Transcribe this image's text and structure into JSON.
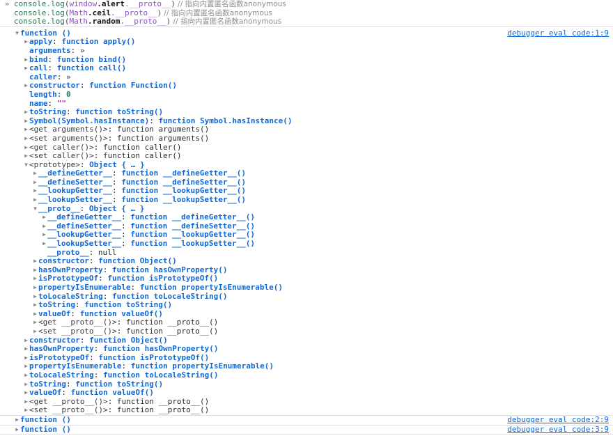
{
  "console": {
    "prompt_chevron": "»",
    "input_lines": [
      {
        "prompt": "»",
        "segments": [
          {
            "t": "console.log",
            "c": "fn"
          },
          {
            "t": "(",
            "c": "punc"
          },
          {
            "t": "window",
            "c": "obj"
          },
          {
            "t": ".alert",
            "c": "prop"
          },
          {
            "t": ".__proto__",
            "c": "obj"
          },
          {
            "t": ")",
            "c": "punc"
          },
          {
            "t": " // 指向内置匿名函数anonymous",
            "c": "comment"
          }
        ]
      },
      {
        "prompt": "",
        "segments": [
          {
            "t": "console.log",
            "c": "fn"
          },
          {
            "t": "(",
            "c": "punc"
          },
          {
            "t": "Math",
            "c": "obj"
          },
          {
            "t": ".ceil",
            "c": "prop"
          },
          {
            "t": ".__proto__",
            "c": "obj"
          },
          {
            "t": ")",
            "c": "punc"
          },
          {
            "t": " // 指向内置匿名函数anonymous",
            "c": "comment"
          }
        ]
      },
      {
        "prompt": "",
        "segments": [
          {
            "t": "console.log",
            "c": "fn"
          },
          {
            "t": "(",
            "c": "punc"
          },
          {
            "t": "Math",
            "c": "obj"
          },
          {
            "t": ".random",
            "c": "prop"
          },
          {
            "t": ".__proto__",
            "c": "obj"
          },
          {
            "t": ")",
            "c": "punc"
          },
          {
            "t": " // 指向内置匿名函数anonymous",
            "c": "comment"
          }
        ]
      }
    ],
    "outputs": [
      {
        "source_link": "debugger eval code:1:9",
        "nodes": [
          {
            "depth": 0,
            "twisty": "open",
            "key": "function ()",
            "key_class": "val-fn",
            "sep": "",
            "value": "",
            "value_class": ""
          },
          {
            "depth": 1,
            "twisty": "closed",
            "key": "apply",
            "key_class": "key",
            "sep": ": ",
            "value": "function apply()",
            "value_class": "val-fn"
          },
          {
            "depth": 1,
            "twisty": "none",
            "key": "arguments",
            "key_class": "key",
            "sep": ": ",
            "value": "»",
            "value_class": "val-plain"
          },
          {
            "depth": 1,
            "twisty": "closed",
            "key": "bind",
            "key_class": "key",
            "sep": ": ",
            "value": "function bind()",
            "value_class": "val-fn"
          },
          {
            "depth": 1,
            "twisty": "closed",
            "key": "call",
            "key_class": "key",
            "sep": ": ",
            "value": "function call()",
            "value_class": "val-fn"
          },
          {
            "depth": 1,
            "twisty": "none",
            "key": "caller",
            "key_class": "key",
            "sep": ": ",
            "value": "»",
            "value_class": "val-plain"
          },
          {
            "depth": 1,
            "twisty": "closed",
            "key": "constructor",
            "key_class": "key",
            "sep": ": ",
            "value": "function Function()",
            "value_class": "val-fn"
          },
          {
            "depth": 1,
            "twisty": "none",
            "key": "length",
            "key_class": "key",
            "sep": ": ",
            "value": "0",
            "value_class": "val-num"
          },
          {
            "depth": 1,
            "twisty": "none",
            "key": "name",
            "key_class": "key",
            "sep": ": ",
            "value": "\"\"",
            "value_class": "val-str"
          },
          {
            "depth": 1,
            "twisty": "closed",
            "key": "toString",
            "key_class": "key",
            "sep": ": ",
            "value": "function toString()",
            "value_class": "val-fn"
          },
          {
            "depth": 1,
            "twisty": "closed",
            "key": "Symbol(Symbol.hasInstance)",
            "key_class": "key",
            "sep": ": ",
            "value": "function Symbol.hasInstance()",
            "value_class": "val-fn"
          },
          {
            "depth": 1,
            "twisty": "closed",
            "key": "<get arguments()>",
            "key_class": "key-dim",
            "sep": ": ",
            "value": "function arguments()",
            "value_class": "val-plain"
          },
          {
            "depth": 1,
            "twisty": "closed",
            "key": "<set arguments()>",
            "key_class": "key-dim",
            "sep": ": ",
            "value": "function arguments()",
            "value_class": "val-plain"
          },
          {
            "depth": 1,
            "twisty": "closed",
            "key": "<get caller()>",
            "key_class": "key-dim",
            "sep": ": ",
            "value": "function caller()",
            "value_class": "val-plain"
          },
          {
            "depth": 1,
            "twisty": "closed",
            "key": "<set caller()>",
            "key_class": "key-dim",
            "sep": ": ",
            "value": "function caller()",
            "value_class": "val-plain"
          },
          {
            "depth": 1,
            "twisty": "open",
            "key": "<prototype>",
            "key_class": "key-dim",
            "sep": ": ",
            "value": "Object { … }",
            "value_class": "val-obj"
          },
          {
            "depth": 2,
            "twisty": "closed",
            "key": "__defineGetter__",
            "key_class": "key",
            "sep": ": ",
            "value": "function __defineGetter__()",
            "value_class": "val-fn"
          },
          {
            "depth": 2,
            "twisty": "closed",
            "key": "__defineSetter__",
            "key_class": "key",
            "sep": ": ",
            "value": "function __defineSetter__()",
            "value_class": "val-fn"
          },
          {
            "depth": 2,
            "twisty": "closed",
            "key": "__lookupGetter__",
            "key_class": "key",
            "sep": ": ",
            "value": "function __lookupGetter__()",
            "value_class": "val-fn"
          },
          {
            "depth": 2,
            "twisty": "closed",
            "key": "__lookupSetter__",
            "key_class": "key",
            "sep": ": ",
            "value": "function __lookupSetter__()",
            "value_class": "val-fn"
          },
          {
            "depth": 2,
            "twisty": "open",
            "key": "__proto__",
            "key_class": "key",
            "sep": ": ",
            "value": "Object { … }",
            "value_class": "val-obj"
          },
          {
            "depth": 3,
            "twisty": "closed",
            "key": "__defineGetter__",
            "key_class": "key",
            "sep": ": ",
            "value": "function __defineGetter__()",
            "value_class": "val-fn"
          },
          {
            "depth": 3,
            "twisty": "closed",
            "key": "__defineSetter__",
            "key_class": "key",
            "sep": ": ",
            "value": "function __defineSetter__()",
            "value_class": "val-fn"
          },
          {
            "depth": 3,
            "twisty": "closed",
            "key": "__lookupGetter__",
            "key_class": "key",
            "sep": ": ",
            "value": "function __lookupGetter__()",
            "value_class": "val-fn"
          },
          {
            "depth": 3,
            "twisty": "closed",
            "key": "__lookupSetter__",
            "key_class": "key",
            "sep": ": ",
            "value": "function __lookupSetter__()",
            "value_class": "val-fn"
          },
          {
            "depth": 3,
            "twisty": "none",
            "key": "__proto__",
            "key_class": "key",
            "sep": ": ",
            "value": "null",
            "value_class": "val-null"
          },
          {
            "depth": 2,
            "twisty": "closed",
            "key": "constructor",
            "key_class": "key",
            "sep": ": ",
            "value": "function Object()",
            "value_class": "val-fn"
          },
          {
            "depth": 2,
            "twisty": "closed",
            "key": "hasOwnProperty",
            "key_class": "key",
            "sep": ": ",
            "value": "function hasOwnProperty()",
            "value_class": "val-fn"
          },
          {
            "depth": 2,
            "twisty": "closed",
            "key": "isPrototypeOf",
            "key_class": "key",
            "sep": ": ",
            "value": "function isPrototypeOf()",
            "value_class": "val-fn"
          },
          {
            "depth": 2,
            "twisty": "closed",
            "key": "propertyIsEnumerable",
            "key_class": "key",
            "sep": ": ",
            "value": "function propertyIsEnumerable()",
            "value_class": "val-fn"
          },
          {
            "depth": 2,
            "twisty": "closed",
            "key": "toLocaleString",
            "key_class": "key",
            "sep": ": ",
            "value": "function toLocaleString()",
            "value_class": "val-fn"
          },
          {
            "depth": 2,
            "twisty": "closed",
            "key": "toString",
            "key_class": "key",
            "sep": ": ",
            "value": "function toString()",
            "value_class": "val-fn"
          },
          {
            "depth": 2,
            "twisty": "closed",
            "key": "valueOf",
            "key_class": "key",
            "sep": ": ",
            "value": "function valueOf()",
            "value_class": "val-fn"
          },
          {
            "depth": 2,
            "twisty": "closed",
            "key": "<get __proto__()>",
            "key_class": "key-dim",
            "sep": ": ",
            "value": "function __proto__()",
            "value_class": "val-plain"
          },
          {
            "depth": 2,
            "twisty": "closed",
            "key": "<set __proto__()>",
            "key_class": "key-dim",
            "sep": ": ",
            "value": "function __proto__()",
            "value_class": "val-plain"
          },
          {
            "depth": 1,
            "twisty": "closed",
            "key": "constructor",
            "key_class": "key",
            "sep": ": ",
            "value": "function Object()",
            "value_class": "val-fn"
          },
          {
            "depth": 1,
            "twisty": "closed",
            "key": "hasOwnProperty",
            "key_class": "key",
            "sep": ": ",
            "value": "function hasOwnProperty()",
            "value_class": "val-fn"
          },
          {
            "depth": 1,
            "twisty": "closed",
            "key": "isPrototypeOf",
            "key_class": "key",
            "sep": ": ",
            "value": "function isPrototypeOf()",
            "value_class": "val-fn"
          },
          {
            "depth": 1,
            "twisty": "closed",
            "key": "propertyIsEnumerable",
            "key_class": "key",
            "sep": ": ",
            "value": "function propertyIsEnumerable()",
            "value_class": "val-fn"
          },
          {
            "depth": 1,
            "twisty": "closed",
            "key": "toLocaleString",
            "key_class": "key",
            "sep": ": ",
            "value": "function toLocaleString()",
            "value_class": "val-fn"
          },
          {
            "depth": 1,
            "twisty": "closed",
            "key": "toString",
            "key_class": "key",
            "sep": ": ",
            "value": "function toString()",
            "value_class": "val-fn"
          },
          {
            "depth": 1,
            "twisty": "closed",
            "key": "valueOf",
            "key_class": "key",
            "sep": ": ",
            "value": "function valueOf()",
            "value_class": "val-fn"
          },
          {
            "depth": 1,
            "twisty": "closed",
            "key": "<get __proto__()>",
            "key_class": "key-dim",
            "sep": ": ",
            "value": "function __proto__()",
            "value_class": "val-plain"
          },
          {
            "depth": 1,
            "twisty": "closed",
            "key": "<set __proto__()>",
            "key_class": "key-dim",
            "sep": ": ",
            "value": "function __proto__()",
            "value_class": "val-plain"
          }
        ]
      },
      {
        "source_link": "debugger eval code:2:9",
        "nodes": [
          {
            "depth": 0,
            "twisty": "closed",
            "key": "function ()",
            "key_class": "val-fn",
            "sep": "",
            "value": "",
            "value_class": ""
          }
        ]
      },
      {
        "source_link": "debugger eval code:3:9",
        "nodes": [
          {
            "depth": 0,
            "twisty": "closed",
            "key": "function ()",
            "key_class": "val-fn",
            "sep": "",
            "value": "",
            "value_class": ""
          }
        ]
      }
    ],
    "twisty_glyphs": {
      "open": "▼",
      "closed": "▶",
      "none": ""
    }
  }
}
